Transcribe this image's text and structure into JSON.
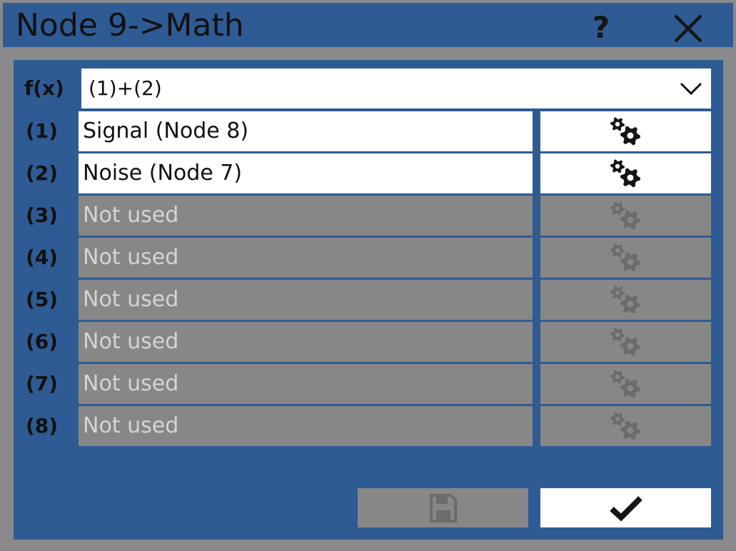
{
  "window": {
    "title": "Node 9->Math",
    "help_label": "?",
    "close_icon": "close-icon"
  },
  "function": {
    "label": "f(x)",
    "value": "(1)+(2)",
    "dropdown_icon": "chevron-down-icon"
  },
  "inputs": [
    {
      "label": "(1)",
      "value": "Signal (Node 8)",
      "enabled": true
    },
    {
      "label": "(2)",
      "value": "Noise (Node 7)",
      "enabled": true
    },
    {
      "label": "(3)",
      "value": "Not used",
      "enabled": false
    },
    {
      "label": "(4)",
      "value": "Not used",
      "enabled": false
    },
    {
      "label": "(5)",
      "value": "Not used",
      "enabled": false
    },
    {
      "label": "(6)",
      "value": "Not used",
      "enabled": false
    },
    {
      "label": "(7)",
      "value": "Not used",
      "enabled": false
    },
    {
      "label": "(8)",
      "value": "Not used",
      "enabled": false
    }
  ],
  "settings_icon": "gears-icon",
  "footer": {
    "save_icon": "save-icon",
    "save_enabled": false,
    "confirm_icon": "checkmark-icon"
  },
  "colors": {
    "accent": "#2f5b94",
    "frame": "#8a8a8c",
    "disabled": "#878787",
    "active": "#ffffff"
  }
}
